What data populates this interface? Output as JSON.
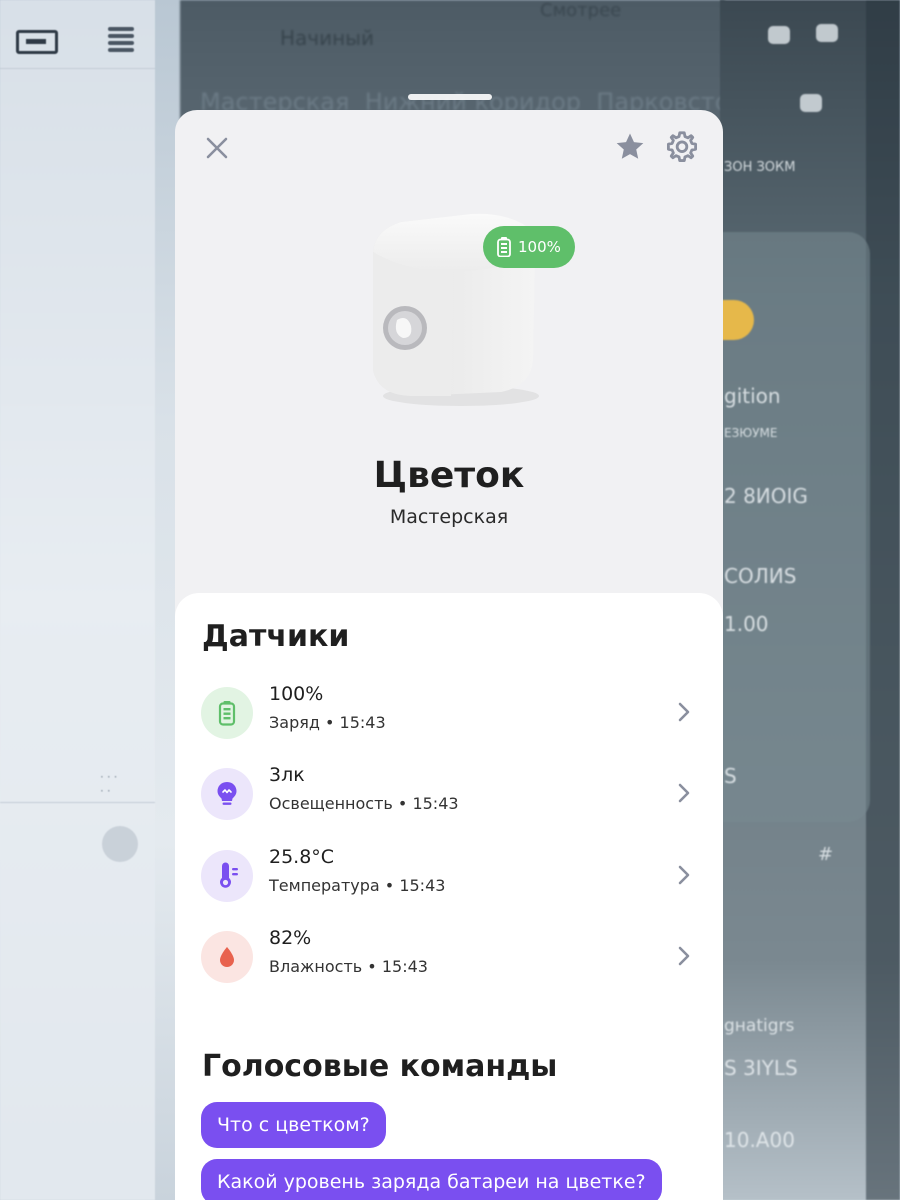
{
  "background": {
    "header_left": "Начиный",
    "header_right": "Смотрее",
    "rooms": [
      "Мастерская",
      "Нижний коридор",
      "Парковстотт"
    ],
    "right_texts": [
      "ЗОН ЗОКМ",
      "gition",
      "ЕЗЮУМЕ",
      "2 8ИОIG",
      "СОЛИS",
      "1.00",
      "S",
      "#",
      "gнatigrs",
      "S 3IYLS",
      "10.A00"
    ]
  },
  "sheet": {
    "battery_badge": "100%",
    "device_name": "Цветок",
    "device_room": "Мастерская"
  },
  "sensors": {
    "title": "Датчики",
    "items": [
      {
        "value": "100%",
        "label": "Заряд • 15:43",
        "icon": "battery-icon",
        "icon_bg": "#e2f4e3",
        "icon_color": "#5fbf6a"
      },
      {
        "value": "3лк",
        "label": "Освещенность • 15:43",
        "icon": "bulb-icon",
        "icon_bg": "#ece6fb",
        "icon_color": "#7a4ff0"
      },
      {
        "value": "25.8°C",
        "label": "Температура • 15:43",
        "icon": "thermometer-icon",
        "icon_bg": "#ece6fb",
        "icon_color": "#7a4ff0"
      },
      {
        "value": "82%",
        "label": "Влажность • 15:43",
        "icon": "drop-icon",
        "icon_bg": "#fbe5e2",
        "icon_color": "#e8624e"
      }
    ]
  },
  "voice": {
    "title": "Голосовые команды",
    "commands": [
      "Что с цветком?",
      "Какой уровень заряда батареи на цветке?"
    ]
  },
  "colors": {
    "accent": "#7a4ff0",
    "battery_green": "#5fbf6a",
    "sheet_bg": "#f1f1f3",
    "icon_gray": "#8a8f9e"
  }
}
